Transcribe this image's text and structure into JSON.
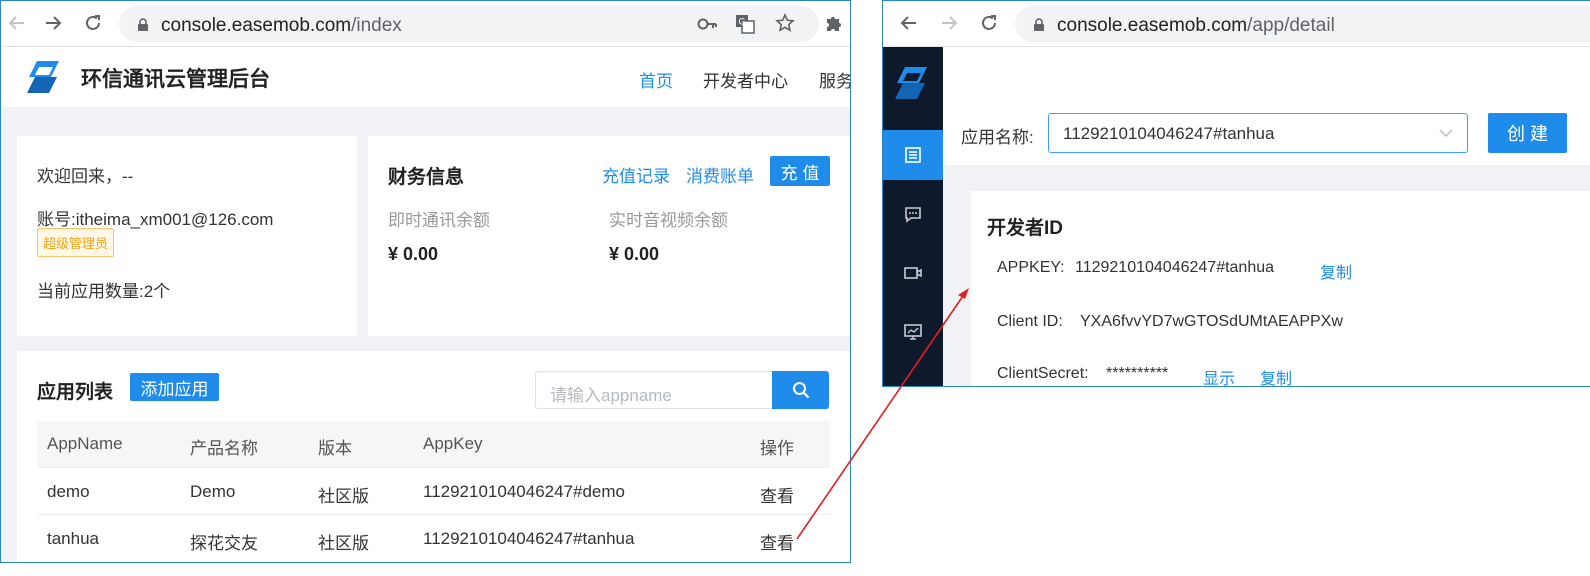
{
  "left_window": {
    "browser": {
      "url_host": "console.easemob.com",
      "url_path": "/index"
    },
    "header": {
      "title": "环信通讯云管理后台",
      "nav": [
        "首页",
        "开发者中心",
        "服务"
      ]
    },
    "welcome_card": {
      "greeting": "欢迎回来，--",
      "account": "账号:itheima_xm001@126.com",
      "role_badge": "超级管理员",
      "app_count": "当前应用数量:2个"
    },
    "finance_card": {
      "title": "财务信息",
      "recharge_record": "充值记录",
      "consumption_bill": "消费账单",
      "recharge_button": "充 值",
      "im_balance_label": "即时通讯余额",
      "im_balance_value": "¥ 0.00",
      "rtc_balance_label": "实时音视频余额",
      "rtc_balance_value": "¥ 0.00"
    },
    "app_list": {
      "title": "应用列表",
      "add_button": "添加应用",
      "search_placeholder": "请输入appname",
      "columns": [
        "AppName",
        "产品名称",
        "版本",
        "AppKey",
        "操作"
      ],
      "rows": [
        {
          "app_name": "demo",
          "product": "Demo",
          "version": "社区版",
          "app_key": "1129210104046247#demo",
          "action": "查看"
        },
        {
          "app_name": "tanhua",
          "product": "探花交友",
          "version": "社区版",
          "app_key": "1129210104046247#tanhua",
          "action": "查看"
        }
      ]
    }
  },
  "right_window": {
    "browser": {
      "url_host": "console.easemob.com",
      "url_path": "/app/detail"
    },
    "app_select": {
      "label": "应用名称:",
      "value": "1129210104046247#tanhua",
      "create_button": "创 建"
    },
    "developer_id": {
      "title": "开发者ID",
      "appkey_label": "APPKEY:",
      "appkey_value": "1129210104046247#tanhua",
      "copy": "复制",
      "client_id_label": "Client ID:",
      "client_id_value": "YXA6fvvYD7wGTOSdUMtAEAPPXw",
      "client_secret_label": "ClientSecret:",
      "client_secret_value": "**********",
      "show": "显示",
      "copy2": "复制"
    }
  },
  "colors": {
    "accent": "#1f8ceb",
    "sidebar": "#0e1a2b",
    "annotation_arrow": "#e02020"
  }
}
